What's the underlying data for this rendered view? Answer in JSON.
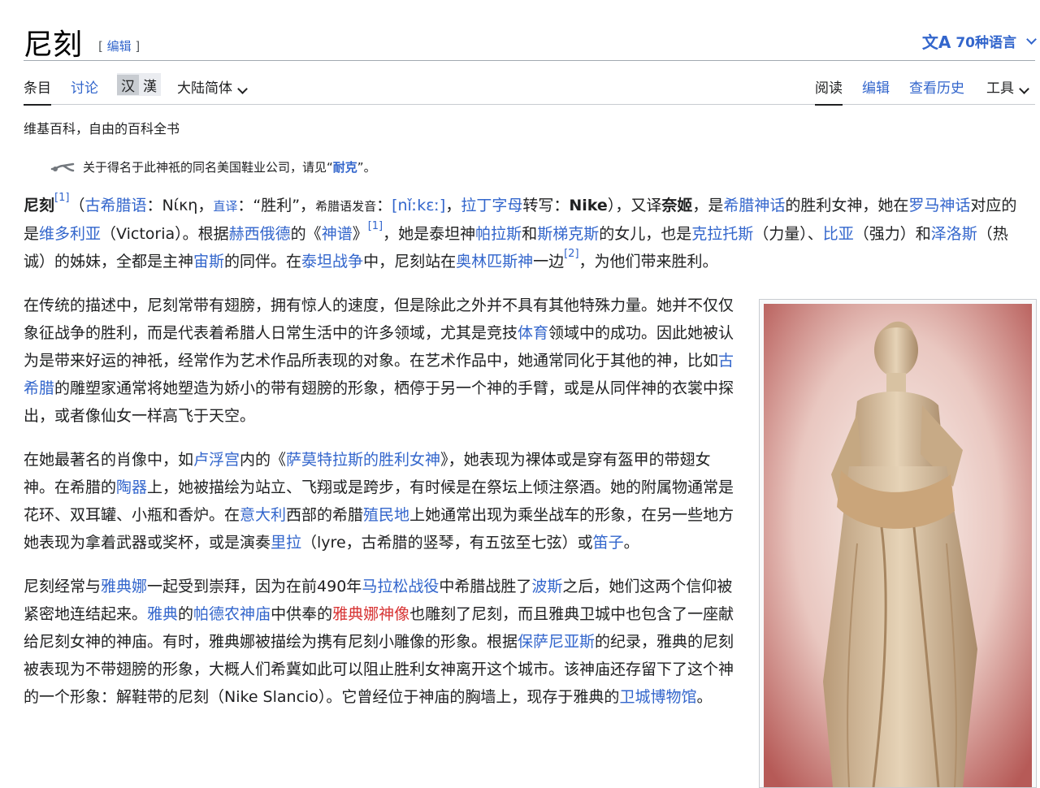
{
  "header": {
    "title": "尼刻",
    "edit_label": "编辑",
    "languages": "70种语言",
    "lang_icon": "translate-icon"
  },
  "tabs": {
    "article": "条目",
    "talk": "讨论",
    "variant_simplified": "汉",
    "variant_traditional": "漢",
    "variant_dropdown": "大陆简体",
    "read": "阅读",
    "edit": "编辑",
    "history": "查看历史",
    "tools": "工具"
  },
  "tagline": "维基百科，自由的百科全书",
  "hatnote": {
    "text": "关于得名于此神祇的同名美国鞋业公司，请见“",
    "link": "耐克",
    "end": "”。"
  },
  "lead": {
    "t0": "尼刻",
    "r1": "[1]",
    "t1": "（",
    "l1": "古希腊语",
    "t2": "：Νίκη，",
    "l2": "直译",
    "t3": "：“胜利”，",
    "t4": "希腊语发音",
    "t5": "：",
    "l3": "[nǐːkɛː]",
    "t6": "，",
    "l4": "拉丁字母",
    "t7": "转写：",
    "t8": "Nike",
    "t9": "），又译",
    "t10": "奈姬",
    "t11": "，是",
    "l5": "希腊神话",
    "t12": "的胜利女神，她在",
    "l6": "罗马神话",
    "t13": "对应的是",
    "l7": "维多利亚",
    "t14": "（Victoria）。根据",
    "l8": "赫西俄德",
    "t15": "的《",
    "l9": "神谱",
    "t16": "》",
    "r2": "[1]",
    "t17": "，她是泰坦神",
    "l10": "帕拉斯",
    "t18": "和",
    "l11": "斯梯克斯",
    "t19": "的女儿，也是",
    "l12": "克拉托斯",
    "t20": "（力量）、",
    "l13": "比亚",
    "t21": "（强力）和",
    "l14": "泽洛斯",
    "t22": "（热诚）的姊妹，全都是主神",
    "l15": "宙斯",
    "t23": "的同伴。在",
    "l16": "泰坦战争",
    "t24": "中，尼刻站在",
    "l17": "奥林匹斯神",
    "t25": "一边",
    "r3": "[2]",
    "t26": "，为他们带来胜利。"
  },
  "p2": {
    "t0": "在传统的描述中，尼刻常带有翅膀，拥有惊人的速度，但是除此之外并不具有其他特殊力量。她并不仅仅象征战争的胜利，而是代表着希腊人日常生活中的许多领域，尤其是竞技",
    "l1": "体育",
    "t1": "领域中的成功。因此她被认为是带来好运的神祇，经常作为艺术作品所表现的对象。在艺术作品中，她通常同化于其他的神，比如",
    "l2": "古希腊",
    "t2": "的雕塑家通常将她塑造为娇小的带有翅膀的形象，栖停于另一个神的手臂，或是从同伴神的衣裳中探出，或者像仙女一样高飞于天空。"
  },
  "p3": {
    "t0": "在她最著名的肖像中，如",
    "l1": "卢浮宫",
    "t1": "内的《",
    "l2": "萨莫特拉斯的胜利女神",
    "t2": "》，她表现为裸体或是穿有盔甲的带翅女神。在希腊的",
    "l3": "陶器",
    "t3": "上，她被描绘为站立、飞翔或是跨步，有时候是在祭坛上倾注祭酒。她的附属物通常是花环、双耳罐、小瓶和香炉。在",
    "l4": "意大利",
    "t4": "西部的希腊",
    "l5": "殖民地",
    "t5": "上她通常出现为乘坐战车的形象，在另一些地方她表现为拿着武器或奖杯，或是演奏",
    "l6": "里拉",
    "t6": "（lyre，古希腊的竖琴，有五弦至七弦）或",
    "l7": "笛子",
    "t7": "。"
  },
  "p4": {
    "t0": "尼刻经常与",
    "l1": "雅典娜",
    "t1": "一起受到崇拜，因为在前490年",
    "l2": "马拉松战役",
    "t2": "中希腊战胜了",
    "l3": "波斯",
    "t3": "之后，她们这两个信仰被紧密地连结起来。",
    "l4": "雅典",
    "t4": "的",
    "l5": "帕德农神庙",
    "t5": "中供奉的",
    "l6": "雅典娜神像",
    "t6": "也雕刻了尼刻，而且雅典卫城中也包含了一座献给尼刻女神的神庙。有时，雅典娜被描绘为携有尼刻小雕像的形象。根据",
    "l7": "保萨尼亚斯",
    "t7": "的纪录，雅典的尼刻被表现为不带翅膀的形象，大概人们希冀如此可以阻止胜利女神离开这个城市。该神庙还存留下了这个神的一个形象：解鞋带的尼刻（Nike Slancio）。它曾经位于神庙的胸墙上，现存于雅典的",
    "l8": "卫城博物馆",
    "t8": "。"
  },
  "colors": {
    "link": "#3366cc",
    "redlink": "#d73333",
    "text": "#202122"
  }
}
